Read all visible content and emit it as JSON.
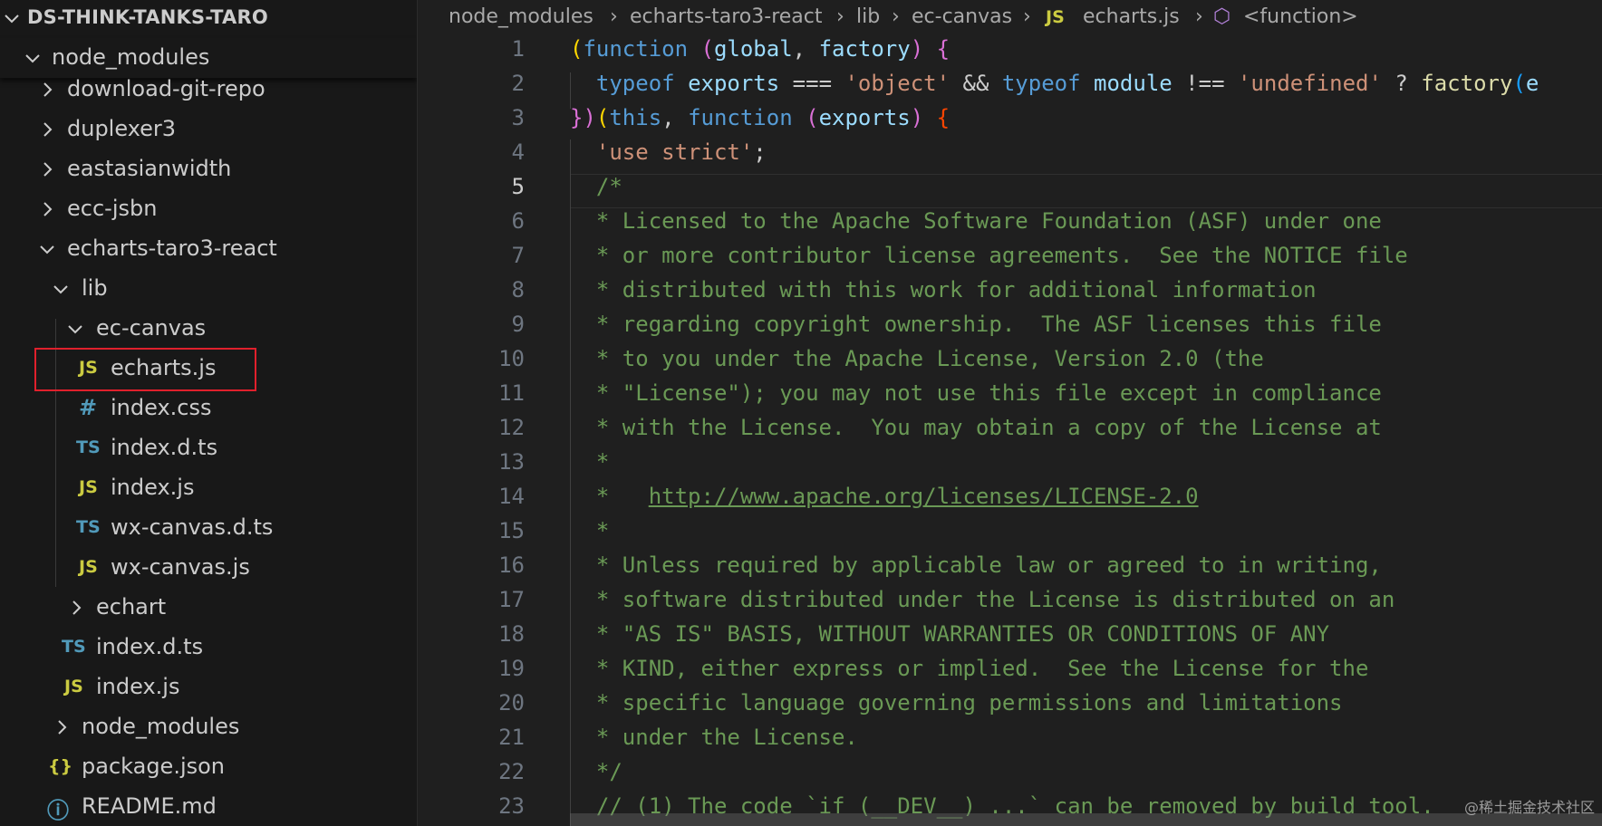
{
  "sidebar": {
    "project_title": "DS-THINK-TANKS-TARO",
    "sticky_folder": "node_modules",
    "items": [
      {
        "label": "download-git-repo",
        "icon": "chevron-right"
      },
      {
        "label": "duplexer3",
        "icon": "chevron-right"
      },
      {
        "label": "eastasianwidth",
        "icon": "chevron-right"
      },
      {
        "label": "ecc-jsbn",
        "icon": "chevron-right"
      },
      {
        "label": "echarts-taro3-react",
        "icon": "chevron-down"
      },
      {
        "label": "lib",
        "icon": "chevron-down"
      },
      {
        "label": "ec-canvas",
        "icon": "chevron-down"
      },
      {
        "label": "echarts.js",
        "icon": "JS",
        "icon_text": "JS"
      },
      {
        "label": "index.css",
        "icon": "#",
        "icon_text": "#"
      },
      {
        "label": "index.d.ts",
        "icon": "TS",
        "icon_text": "TS"
      },
      {
        "label": "index.js",
        "icon": "JS",
        "icon_text": "JS"
      },
      {
        "label": "wx-canvas.d.ts",
        "icon": "TS",
        "icon_text": "TS"
      },
      {
        "label": "wx-canvas.js",
        "icon": "JS",
        "icon_text": "JS"
      },
      {
        "label": "echart",
        "icon": "chevron-right"
      },
      {
        "label": "index.d.ts",
        "icon": "TS",
        "icon_text": "TS"
      },
      {
        "label": "index.js",
        "icon": "JS",
        "icon_text": "JS"
      },
      {
        "label": "node_modules",
        "icon": "chevron-right"
      },
      {
        "label": "package.json",
        "icon": "{}",
        "icon_text": "{}"
      },
      {
        "label": "README.md",
        "icon": "info",
        "icon_text": "ⓘ"
      }
    ]
  },
  "breadcrumb": {
    "items": [
      "node_modules",
      "echarts-taro3-react",
      "lib",
      "ec-canvas",
      "echarts.js",
      "<function>"
    ],
    "file_icon": "JS",
    "symbol_icon": "⬡"
  },
  "editor": {
    "line_numbers": [
      "1",
      "2",
      "3",
      "4",
      "5",
      "6",
      "7",
      "8",
      "9",
      "10",
      "11",
      "12",
      "13",
      "14",
      "15",
      "16",
      "17",
      "18",
      "19",
      "20",
      "21",
      "22",
      "23"
    ],
    "active_line": "5",
    "lines": {
      "l1": {
        "t1": "(",
        "t2": "function",
        "t3": " ",
        "t4": "(",
        "t5": "global",
        "t6": ", ",
        "t7": "factory",
        "t8": ") ",
        "t9": "{"
      },
      "l2": {
        "t1": "  ",
        "t2": "typeof",
        "t3": " ",
        "t4": "exports",
        "t5": " === ",
        "t6": "'object'",
        "t7": " && ",
        "t8": "typeof",
        "t9": " ",
        "t10": "module",
        "t11": " !== ",
        "t12": "'undefined'",
        "t13": " ? ",
        "t14": "factory",
        "t15": "(",
        "t16": "e"
      },
      "l3": {
        "t1": "})",
        "t2": "(",
        "t3": "this",
        "t4": ", ",
        "t5": "function",
        "t6": " ",
        "t7": "(",
        "t8": "exports",
        "t9": ") ",
        "t10": "{"
      },
      "l4": {
        "t1": "  ",
        "t2": "'use strict'",
        "t3": ";"
      },
      "l5": "  /*",
      "l6": "  * Licensed to the Apache Software Foundation (ASF) under one",
      "l7": "  * or more contributor license agreements.  See the NOTICE file",
      "l8": "  * distributed with this work for additional information",
      "l9": "  * regarding copyright ownership.  The ASF licenses this file",
      "l10": "  * to you under the Apache License, Version 2.0 (the",
      "l11": "  * \"License\"); you may not use this file except in compliance",
      "l12": "  * with the License.  You may obtain a copy of the License at",
      "l13": "  *",
      "l14": {
        "t1": "  *   ",
        "t2": "http://www.apache.org/licenses/LICENSE-2.0"
      },
      "l15": "  *",
      "l16": "  * Unless required by applicable law or agreed to in writing,",
      "l17": "  * software distributed under the License is distributed on an",
      "l18": "  * \"AS IS\" BASIS, WITHOUT WARRANTIES OR CONDITIONS OF ANY",
      "l19": "  * KIND, either express or implied.  See the License for the",
      "l20": "  * specific language governing permissions and limitations",
      "l21": "  * under the License.",
      "l22": "  */",
      "l23": "  // (1) The code `if (__DEV__) ...` can be removed by build tool."
    }
  },
  "watermark": "@稀土掘金技术社区",
  "colors": {
    "highlight_border": "#e0202c",
    "js_icon": "#cbcb41",
    "ts_icon": "#519aba",
    "comment": "#6a9955",
    "keyword": "#569cd6",
    "string": "#ce9178"
  }
}
